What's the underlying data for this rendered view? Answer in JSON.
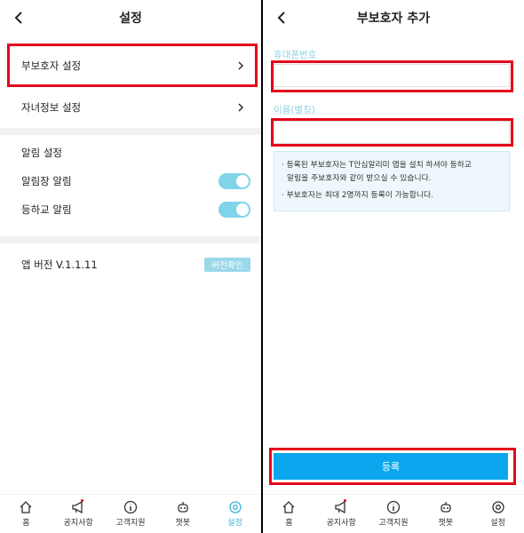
{
  "settings": {
    "title": "설정",
    "guardian_settings": "부보호자 설정",
    "child_info_settings": "자녀정보 설정",
    "notification_section": "알림 설정",
    "attendance_alert": "알림장 알림",
    "school_alert": "등하교 알림",
    "app_version": "앱 버전 V.1.1.11",
    "version_check": "버전확인",
    "toggles": {
      "attendance_alert_on": true,
      "school_alert_on": true
    }
  },
  "add_guardian": {
    "title": "부보호자 추가",
    "phone_label": "휴대폰번호",
    "phone_value": "",
    "name_label": "이름(별칭)",
    "name_value": "",
    "info_line1": "· 등록된 부보호자는 T안심알리미 앱을 설치 하셔야 등하교",
    "info_line1b": "알림을 주보호자와 같이 받으실 수 있습니다.",
    "info_line2": "· 부보호자는 최대 2명까지 등록이 가능합니다.",
    "submit": "등록"
  },
  "nav": {
    "home": "홈",
    "notice": "공지사항",
    "support": "고객지원",
    "chatbot": "챗봇",
    "settings": "설정"
  },
  "colors": {
    "accent": "#39b6d8",
    "highlight": "#e3061b",
    "button": "#0aa7ef",
    "toggle": "#7fd4ea"
  }
}
